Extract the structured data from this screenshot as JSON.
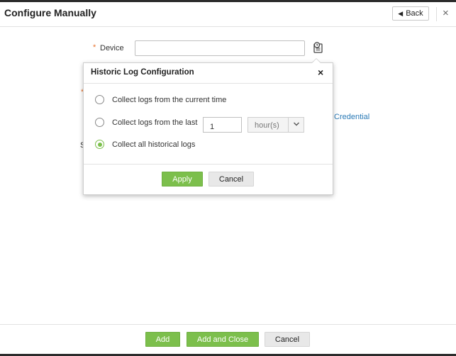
{
  "header": {
    "title": "Configure Manually",
    "back_label": "Back",
    "close_icon": "×"
  },
  "form": {
    "device_label": "Device",
    "device_value": "",
    "required_mark": "*",
    "credential_link": "Credential",
    "stray_text": "S"
  },
  "popup": {
    "title": "Historic Log Configuration",
    "close_icon": "×",
    "options": [
      {
        "label": "Collect logs from the current time",
        "selected": false
      },
      {
        "label": "Collect logs from the last",
        "selected": false
      },
      {
        "label": "Collect all historical logs",
        "selected": true
      }
    ],
    "last_value": "1",
    "unit_selected": "hour(s)",
    "apply_label": "Apply",
    "cancel_label": "Cancel"
  },
  "footer": {
    "add_label": "Add",
    "add_close_label": "Add and Close",
    "cancel_label": "Cancel"
  },
  "colors": {
    "accent_green": "#7cbf4c",
    "link_blue": "#2a7ab6",
    "required_orange": "#e8712b"
  }
}
